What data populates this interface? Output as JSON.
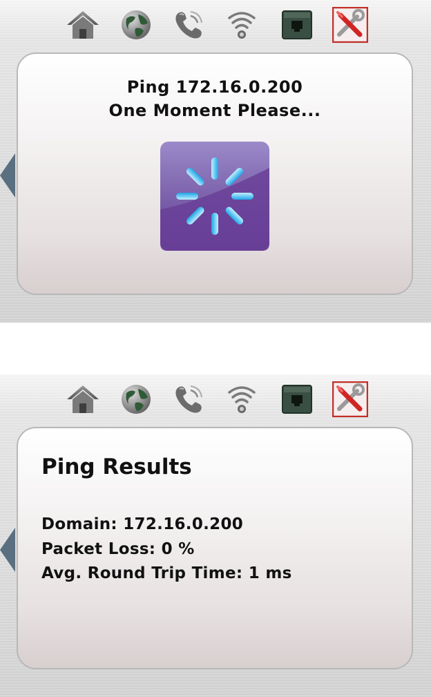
{
  "icons": {
    "home": "home-icon",
    "globe": "globe-icon",
    "phone": "phone-icon",
    "wireless": "wireless-icon",
    "ethernet": "ethernet-icon",
    "tools": "tools-icon"
  },
  "colors": {
    "spinner_bg": "#6a3f98",
    "spinner_ray": "#3fc8f5",
    "back_arrow": "#5a6f80",
    "tools_border": "#c0302a"
  },
  "progress_screen": {
    "title": "Ping 172.16.0.200",
    "subtitle": "One Moment Please..."
  },
  "results_screen": {
    "title": "Ping Results",
    "domain": "Domain: 172.16.0.200",
    "packet_loss": "Packet Loss: 0 %",
    "avg_rtt": "Avg. Round Trip Time: 1 ms"
  }
}
